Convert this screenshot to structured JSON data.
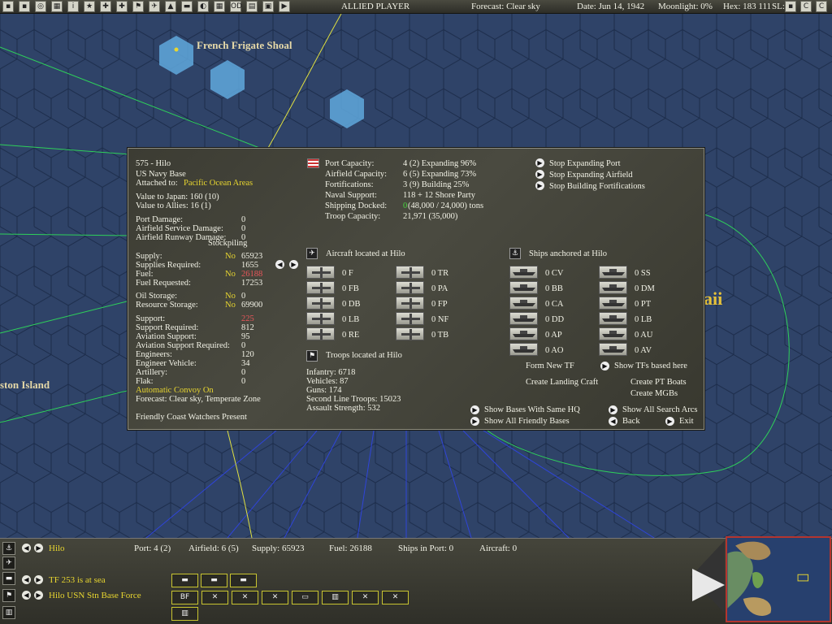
{
  "topbar": {
    "player": "ALLIED PLAYER",
    "forecast": "Forecast: Clear sky",
    "date": "Date: Jun 14, 1942",
    "moonlight": "Moonlight: 0%",
    "hex": "Hex: 183 111",
    "sl": "SL:",
    "buttons": [
      "▪",
      "▪",
      "◎",
      "▦",
      "i",
      "★",
      "✚",
      "✚",
      "⚑",
      "✈",
      "▲",
      "▬",
      "◐",
      "▦",
      "OD",
      "▤",
      "▣",
      "▶"
    ],
    "right_buttons": [
      "▪",
      "C",
      "C"
    ]
  },
  "map": {
    "labels": {
      "shoal": "French Frigate Shoal",
      "island": "ston Island",
      "hawaii": "aii"
    }
  },
  "base": {
    "name": "575 - Hilo",
    "type": "US Navy Base",
    "attached_label": "Attached to:",
    "attached_value": "Pacific Ocean Areas",
    "value_japan": "Value to Japan: 160 (10)",
    "value_allies": "Value to Allies: 16 (1)",
    "damage": [
      {
        "label": "Port Damage:",
        "value": "0"
      },
      {
        "label": "Airfield Service Damage:",
        "value": "0"
      },
      {
        "label": "Airfield Runway Damage:",
        "value": "0"
      }
    ],
    "stockpiling": "Stockpiling",
    "supply": [
      {
        "label": "Supply:",
        "flag": "No",
        "value": "65923"
      },
      {
        "label": "Supplies Required:",
        "flag": "",
        "value": "1655"
      },
      {
        "label": "Fuel:",
        "flag": "No",
        "value": "26188"
      },
      {
        "label": "Fuel Requested:",
        "flag": "",
        "value": "17253"
      }
    ],
    "storage": [
      {
        "label": "Oil Storage:",
        "flag": "No",
        "value": "0"
      },
      {
        "label": "Resource Storage:",
        "flag": "No",
        "value": "69900"
      }
    ],
    "support": [
      {
        "label": "Support:",
        "value": "225"
      },
      {
        "label": "Support Required:",
        "value": "812"
      },
      {
        "label": "Aviation Support:",
        "value": "95"
      },
      {
        "label": "Aviation Support Required:",
        "value": "0"
      },
      {
        "label": "Engineers:",
        "value": "120"
      },
      {
        "label": "Engineer Vehicle:",
        "value": "34"
      },
      {
        "label": "Artillery:",
        "value": "0"
      },
      {
        "label": "Flak:",
        "value": "0"
      }
    ],
    "convoy": "Automatic Convoy On",
    "forecast": "Forecast: Clear sky, Temperate Zone",
    "coastwatchers": "Friendly Coast Watchers Present"
  },
  "capacity": [
    {
      "label": "Port Capacity:",
      "value": "4 (2) Expanding 96%"
    },
    {
      "label": "Airfield Capacity:",
      "value": "6 (5) Expanding 73%"
    },
    {
      "label": "Fortifications:",
      "value": "3 (9) Building 25%"
    },
    {
      "label": "Naval Support:",
      "value": "118 + 12 Shore Party"
    },
    {
      "label": "Shipping Docked:",
      "value_green": "0",
      "value": " (48,000 / 24,000) tons"
    },
    {
      "label": "Troop Capacity:",
      "value": "21,971       (35,000)"
    }
  ],
  "actions": [
    "Stop Expanding Port",
    "Stop Expanding Airfield",
    "Stop Building Fortifications"
  ],
  "aircraft": {
    "title": "Aircraft located at Hilo",
    "left": [
      "0 F",
      "0 FB",
      "0 DB",
      "0 LB",
      "0 RE"
    ],
    "right": [
      "0 TR",
      "0 PA",
      "0 FP",
      "0 NF",
      "0 TB"
    ]
  },
  "ships": {
    "title": "Ships anchored at Hilo",
    "left": [
      "0 CV",
      "0 BB",
      "0 CA",
      "0 DD",
      "0 AP",
      "0 AO"
    ],
    "right": [
      "0 SS",
      "0 DM",
      "0 PT",
      "0 LB",
      "0 AU",
      "0 AV"
    ]
  },
  "ship_actions": {
    "form_tf": "Form New TF",
    "show_tfs": "Show TFs based here",
    "landing_craft": "Create Landing Craft",
    "pt_boats": "Create PT Boats",
    "mgbs": "Create MGBs"
  },
  "troops": {
    "title": "Troops located at Hilo",
    "lines": [
      "Infantry: 6718",
      "Vehicles: 87",
      "Guns: 174",
      "Second Line Troops: 15023",
      "Assault Strength: 532"
    ]
  },
  "nav": {
    "same_hq": "Show Bases With Same HQ",
    "all_friendly": "Show All Friendly Bases",
    "search_arcs": "Show All Search Arcs",
    "back": "Back",
    "exit": "Exit"
  },
  "bottom": {
    "base_name": "Hilo",
    "port": "Port: 4 (2)",
    "airfield": "Airfield: 6 (5)",
    "supply": "Supply: 65923",
    "fuel": "Fuel: 26188",
    "ships_in_port": "Ships in Port: 0",
    "aircraft": "Aircraft: 0",
    "tf": "TF 253 is at sea",
    "force": "Hilo USN Stn Base Force",
    "unit_buttons": [
      "BF",
      "✕",
      "✕",
      "✕",
      "▭",
      "▥",
      "✕",
      "✕"
    ]
  },
  "colors": {
    "sea": "#2b3f63",
    "highlight": "#e8d630",
    "alert": "#e8565a",
    "green": "#4ad840"
  }
}
